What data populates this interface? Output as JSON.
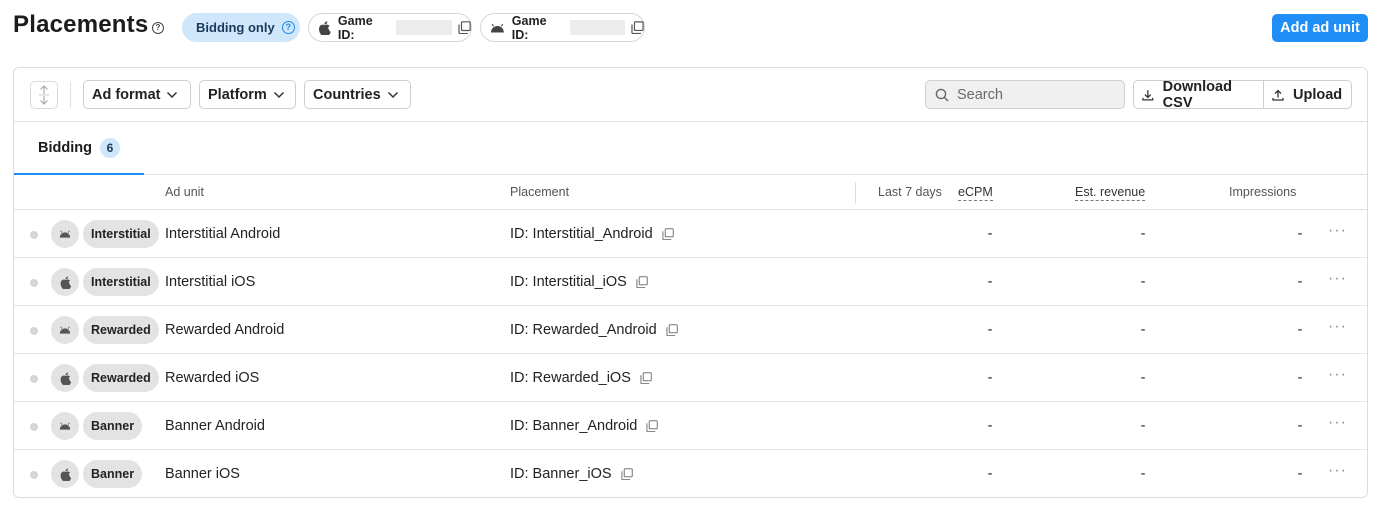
{
  "header": {
    "title": "Placements",
    "bidding_only": "Bidding only",
    "game_ids": [
      {
        "platform": "apple-icon",
        "label": "Game ID:"
      },
      {
        "platform": "android-icon",
        "label": "Game ID:"
      }
    ],
    "add_button": "Add ad unit"
  },
  "toolbar": {
    "filters": [
      "Ad format",
      "Platform",
      "Countries"
    ],
    "search_placeholder": "Search",
    "download_csv": "Download CSV",
    "upload": "Upload"
  },
  "tabs": [
    {
      "label": "Bidding",
      "count": "6"
    }
  ],
  "table": {
    "columns": {
      "ad_unit": "Ad unit",
      "placement": "Placement",
      "period": "Last 7 days",
      "ecpm": "eCPM",
      "revenue": "Est. revenue",
      "impressions": "Impressions"
    },
    "rows": [
      {
        "platform": "android",
        "format": "Interstitial",
        "ad_unit": "Interstitial Android",
        "placement": "ID: Interstitial_Android",
        "ecpm": "-",
        "revenue": "-",
        "impressions": "-"
      },
      {
        "platform": "ios",
        "format": "Interstitial",
        "ad_unit": "Interstitial iOS",
        "placement": "ID: Interstitial_iOS",
        "ecpm": "-",
        "revenue": "-",
        "impressions": "-"
      },
      {
        "platform": "android",
        "format": "Rewarded",
        "ad_unit": "Rewarded Android",
        "placement": "ID: Rewarded_Android",
        "ecpm": "-",
        "revenue": "-",
        "impressions": "-"
      },
      {
        "platform": "ios",
        "format": "Rewarded",
        "ad_unit": "Rewarded iOS",
        "placement": "ID: Rewarded_iOS",
        "ecpm": "-",
        "revenue": "-",
        "impressions": "-"
      },
      {
        "platform": "android",
        "format": "Banner",
        "ad_unit": "Banner Android",
        "placement": "ID: Banner_Android",
        "ecpm": "-",
        "revenue": "-",
        "impressions": "-"
      },
      {
        "platform": "ios",
        "format": "Banner",
        "ad_unit": "Banner iOS",
        "placement": "ID: Banner_iOS",
        "ecpm": "-",
        "revenue": "-",
        "impressions": "-"
      }
    ]
  },
  "colors": {
    "accent": "#1f8ff7",
    "pill_blue": "#cfe6fb",
    "chip_gray": "#e3e3e3"
  }
}
